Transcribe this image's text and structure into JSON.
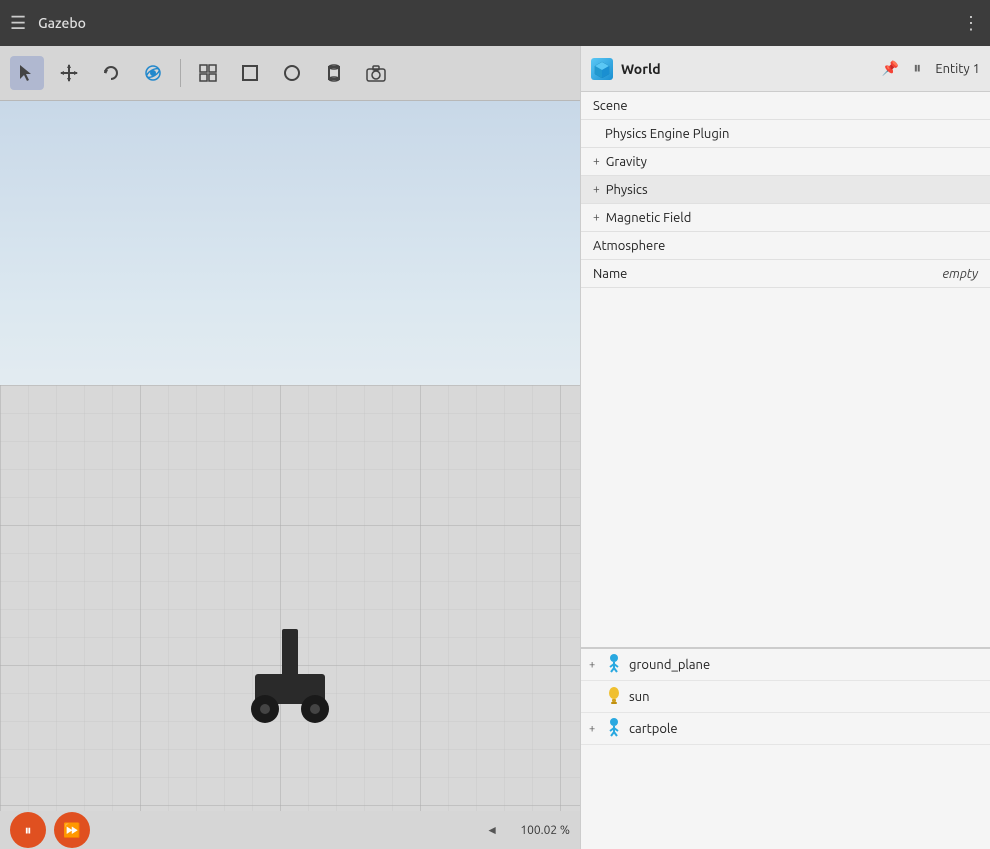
{
  "app": {
    "title": "Gazebo",
    "menu_icon": "☰",
    "more_icon": "⋮"
  },
  "toolbar": {
    "tools": [
      {
        "name": "select",
        "icon": "↖",
        "active": true
      },
      {
        "name": "move",
        "icon": "✛",
        "active": false
      },
      {
        "name": "rotate",
        "icon": "↺",
        "active": false
      },
      {
        "name": "orbit",
        "icon": "🌐",
        "active": false
      },
      {
        "name": "grid",
        "icon": "⊞",
        "active": false
      },
      {
        "name": "box",
        "icon": "◻",
        "active": false
      },
      {
        "name": "sphere",
        "icon": "●",
        "active": false
      },
      {
        "name": "cylinder",
        "icon": "⬛",
        "active": false
      },
      {
        "name": "camera",
        "icon": "📷",
        "active": false
      }
    ]
  },
  "world": {
    "title": "World",
    "entity_label": "Entity 1",
    "properties": [
      {
        "label": "Scene",
        "value": "",
        "expandable": false,
        "indent": 0
      },
      {
        "label": "Physics Engine Plugin",
        "value": "",
        "expandable": false,
        "indent": 1
      },
      {
        "label": "Gravity",
        "value": "",
        "expandable": true,
        "indent": 0
      },
      {
        "label": "Physics",
        "value": "",
        "expandable": true,
        "indent": 0
      },
      {
        "label": "Magnetic Field",
        "value": "",
        "expandable": true,
        "indent": 0
      },
      {
        "label": "Atmosphere",
        "value": "",
        "expandable": false,
        "indent": 0
      },
      {
        "label": "Name",
        "value": "empty",
        "expandable": false,
        "indent": 0
      }
    ]
  },
  "entities": [
    {
      "name": "ground_plane",
      "icon": "person",
      "expandable": true
    },
    {
      "name": "sun",
      "icon": "light",
      "expandable": false
    },
    {
      "name": "cartpole",
      "icon": "person",
      "expandable": true
    }
  ],
  "viewport": {
    "zoom_label": "100.02 %",
    "zoom_arrow": "◄"
  },
  "controls": {
    "pause_label": "⏸",
    "ff_label": "⏩"
  }
}
